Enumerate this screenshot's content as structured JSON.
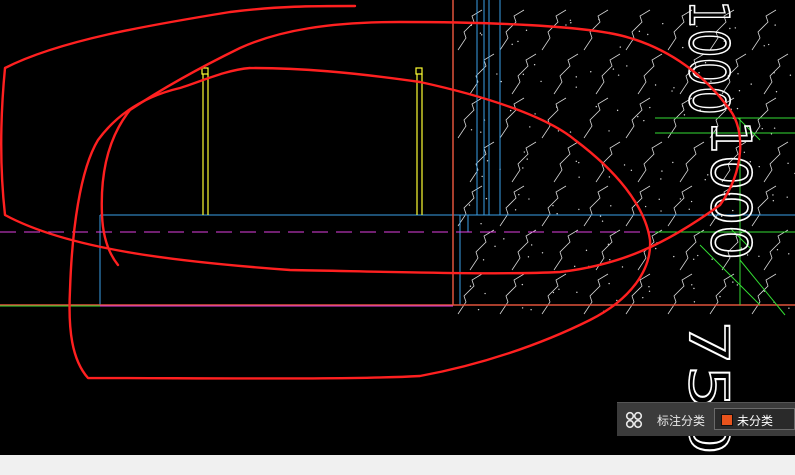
{
  "cad": {
    "background": "#000000",
    "colors": {
      "boundary": "#e0523a",
      "structure": "#3aa0e8",
      "rail": "#ffff33",
      "dimension": "#33dd33",
      "centerline": "#e040e0",
      "hatch": "#d8d8d8",
      "markup": "#ff2020"
    },
    "dimension_labels": [
      "1000",
      "1000",
      "750"
    ]
  },
  "annotation_panel": {
    "icon": "annotation-category-icon",
    "label": "标注分类",
    "selected_value": "未分类",
    "selected_color": "#e8531c"
  }
}
